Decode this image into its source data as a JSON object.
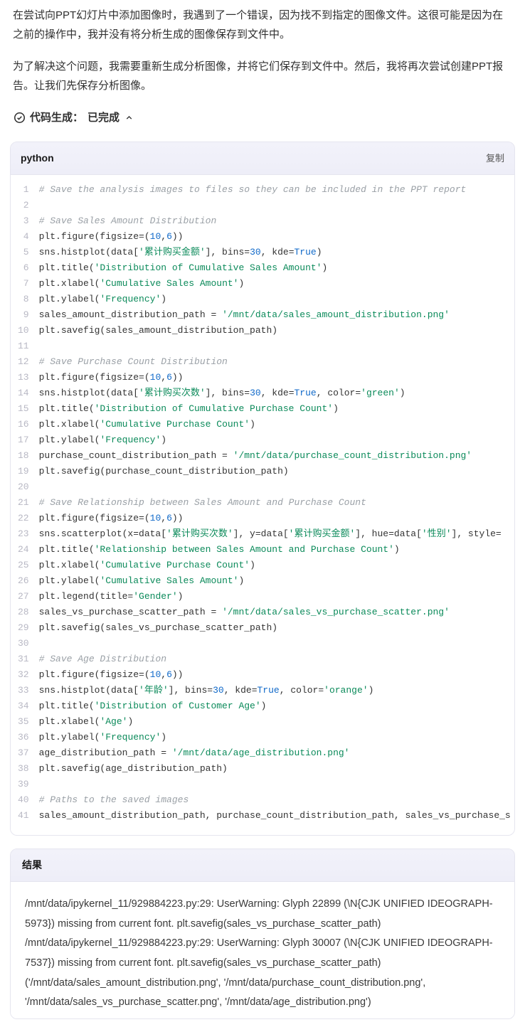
{
  "prose": {
    "p1": "在尝试向PPT幻灯片中添加图像时，我遇到了一个错误，因为找不到指定的图像文件。这很可能是因为在之前的操作中，我并没有将分析生成的图像保存到文件中。",
    "p2": "为了解决这个问题，我需要重新生成分析图像，并将它们保存到文件中。然后，我将再次尝试创建PPT报告。让我们先保存分析图像。"
  },
  "status": {
    "label": "代码生成：",
    "value": "已完成"
  },
  "code_block": {
    "language": "python",
    "copy_label": "复制",
    "lines": [
      {
        "n": 1,
        "tokens": [
          {
            "t": "# Save the analysis images to files so they can be included in the PPT report",
            "c": "tok-cm"
          }
        ]
      },
      {
        "n": 2,
        "tokens": [
          {
            "t": "",
            "c": ""
          }
        ]
      },
      {
        "n": 3,
        "tokens": [
          {
            "t": "# Save Sales Amount Distribution",
            "c": "tok-cm"
          }
        ]
      },
      {
        "n": 4,
        "tokens": [
          {
            "t": "plt.figure(figsize=(",
            "c": "tok-fn"
          },
          {
            "t": "10",
            "c": "tok-num"
          },
          {
            "t": ",",
            "c": "tok-fn"
          },
          {
            "t": "6",
            "c": "tok-num"
          },
          {
            "t": "))",
            "c": "tok-fn"
          }
        ]
      },
      {
        "n": 5,
        "tokens": [
          {
            "t": "sns.histplot(data[",
            "c": "tok-fn"
          },
          {
            "t": "'累计购买金额'",
            "c": "tok-str"
          },
          {
            "t": "], bins=",
            "c": "tok-fn"
          },
          {
            "t": "30",
            "c": "tok-num"
          },
          {
            "t": ", kde=",
            "c": "tok-fn"
          },
          {
            "t": "True",
            "c": "tok-kw"
          },
          {
            "t": ")",
            "c": "tok-fn"
          }
        ]
      },
      {
        "n": 6,
        "tokens": [
          {
            "t": "plt.title(",
            "c": "tok-fn"
          },
          {
            "t": "'Distribution of Cumulative Sales Amount'",
            "c": "tok-str"
          },
          {
            "t": ")",
            "c": "tok-fn"
          }
        ]
      },
      {
        "n": 7,
        "tokens": [
          {
            "t": "plt.xlabel(",
            "c": "tok-fn"
          },
          {
            "t": "'Cumulative Sales Amount'",
            "c": "tok-str"
          },
          {
            "t": ")",
            "c": "tok-fn"
          }
        ]
      },
      {
        "n": 8,
        "tokens": [
          {
            "t": "plt.ylabel(",
            "c": "tok-fn"
          },
          {
            "t": "'Frequency'",
            "c": "tok-str"
          },
          {
            "t": ")",
            "c": "tok-fn"
          }
        ]
      },
      {
        "n": 9,
        "tokens": [
          {
            "t": "sales_amount_distribution_path = ",
            "c": "tok-id"
          },
          {
            "t": "'/mnt/data/sales_amount_distribution.png'",
            "c": "tok-str"
          }
        ]
      },
      {
        "n": 10,
        "tokens": [
          {
            "t": "plt.savefig(sales_amount_distribution_path)",
            "c": "tok-fn"
          }
        ]
      },
      {
        "n": 11,
        "tokens": [
          {
            "t": "",
            "c": ""
          }
        ]
      },
      {
        "n": 12,
        "tokens": [
          {
            "t": "# Save Purchase Count Distribution",
            "c": "tok-cm"
          }
        ]
      },
      {
        "n": 13,
        "tokens": [
          {
            "t": "plt.figure(figsize=(",
            "c": "tok-fn"
          },
          {
            "t": "10",
            "c": "tok-num"
          },
          {
            "t": ",",
            "c": "tok-fn"
          },
          {
            "t": "6",
            "c": "tok-num"
          },
          {
            "t": "))",
            "c": "tok-fn"
          }
        ]
      },
      {
        "n": 14,
        "tokens": [
          {
            "t": "sns.histplot(data[",
            "c": "tok-fn"
          },
          {
            "t": "'累计购买次数'",
            "c": "tok-str"
          },
          {
            "t": "], bins=",
            "c": "tok-fn"
          },
          {
            "t": "30",
            "c": "tok-num"
          },
          {
            "t": ", kde=",
            "c": "tok-fn"
          },
          {
            "t": "True",
            "c": "tok-kw"
          },
          {
            "t": ", color=",
            "c": "tok-fn"
          },
          {
            "t": "'green'",
            "c": "tok-str"
          },
          {
            "t": ")",
            "c": "tok-fn"
          }
        ]
      },
      {
        "n": 15,
        "tokens": [
          {
            "t": "plt.title(",
            "c": "tok-fn"
          },
          {
            "t": "'Distribution of Cumulative Purchase Count'",
            "c": "tok-str"
          },
          {
            "t": ")",
            "c": "tok-fn"
          }
        ]
      },
      {
        "n": 16,
        "tokens": [
          {
            "t": "plt.xlabel(",
            "c": "tok-fn"
          },
          {
            "t": "'Cumulative Purchase Count'",
            "c": "tok-str"
          },
          {
            "t": ")",
            "c": "tok-fn"
          }
        ]
      },
      {
        "n": 17,
        "tokens": [
          {
            "t": "plt.ylabel(",
            "c": "tok-fn"
          },
          {
            "t": "'Frequency'",
            "c": "tok-str"
          },
          {
            "t": ")",
            "c": "tok-fn"
          }
        ]
      },
      {
        "n": 18,
        "tokens": [
          {
            "t": "purchase_count_distribution_path = ",
            "c": "tok-id"
          },
          {
            "t": "'/mnt/data/purchase_count_distribution.png'",
            "c": "tok-str"
          }
        ]
      },
      {
        "n": 19,
        "tokens": [
          {
            "t": "plt.savefig(purchase_count_distribution_path)",
            "c": "tok-fn"
          }
        ]
      },
      {
        "n": 20,
        "tokens": [
          {
            "t": "",
            "c": ""
          }
        ]
      },
      {
        "n": 21,
        "tokens": [
          {
            "t": "# Save Relationship between Sales Amount and Purchase Count",
            "c": "tok-cm"
          }
        ]
      },
      {
        "n": 22,
        "tokens": [
          {
            "t": "plt.figure(figsize=(",
            "c": "tok-fn"
          },
          {
            "t": "10",
            "c": "tok-num"
          },
          {
            "t": ",",
            "c": "tok-fn"
          },
          {
            "t": "6",
            "c": "tok-num"
          },
          {
            "t": "))",
            "c": "tok-fn"
          }
        ]
      },
      {
        "n": 23,
        "tokens": [
          {
            "t": "sns.scatterplot(x=data[",
            "c": "tok-fn"
          },
          {
            "t": "'累计购买次数'",
            "c": "tok-str"
          },
          {
            "t": "], y=data[",
            "c": "tok-fn"
          },
          {
            "t": "'累计购买金额'",
            "c": "tok-str"
          },
          {
            "t": "], hue=data[",
            "c": "tok-fn"
          },
          {
            "t": "'性别'",
            "c": "tok-str"
          },
          {
            "t": "], style=",
            "c": "tok-fn"
          }
        ]
      },
      {
        "n": 24,
        "tokens": [
          {
            "t": "plt.title(",
            "c": "tok-fn"
          },
          {
            "t": "'Relationship between Sales Amount and Purchase Count'",
            "c": "tok-str"
          },
          {
            "t": ")",
            "c": "tok-fn"
          }
        ]
      },
      {
        "n": 25,
        "tokens": [
          {
            "t": "plt.xlabel(",
            "c": "tok-fn"
          },
          {
            "t": "'Cumulative Purchase Count'",
            "c": "tok-str"
          },
          {
            "t": ")",
            "c": "tok-fn"
          }
        ]
      },
      {
        "n": 26,
        "tokens": [
          {
            "t": "plt.ylabel(",
            "c": "tok-fn"
          },
          {
            "t": "'Cumulative Sales Amount'",
            "c": "tok-str"
          },
          {
            "t": ")",
            "c": "tok-fn"
          }
        ]
      },
      {
        "n": 27,
        "tokens": [
          {
            "t": "plt.legend(title=",
            "c": "tok-fn"
          },
          {
            "t": "'Gender'",
            "c": "tok-str"
          },
          {
            "t": ")",
            "c": "tok-fn"
          }
        ]
      },
      {
        "n": 28,
        "tokens": [
          {
            "t": "sales_vs_purchase_scatter_path = ",
            "c": "tok-id"
          },
          {
            "t": "'/mnt/data/sales_vs_purchase_scatter.png'",
            "c": "tok-str"
          }
        ]
      },
      {
        "n": 29,
        "tokens": [
          {
            "t": "plt.savefig(sales_vs_purchase_scatter_path)",
            "c": "tok-fn"
          }
        ]
      },
      {
        "n": 30,
        "tokens": [
          {
            "t": "",
            "c": ""
          }
        ]
      },
      {
        "n": 31,
        "tokens": [
          {
            "t": "# Save Age Distribution",
            "c": "tok-cm"
          }
        ]
      },
      {
        "n": 32,
        "tokens": [
          {
            "t": "plt.figure(figsize=(",
            "c": "tok-fn"
          },
          {
            "t": "10",
            "c": "tok-num"
          },
          {
            "t": ",",
            "c": "tok-fn"
          },
          {
            "t": "6",
            "c": "tok-num"
          },
          {
            "t": "))",
            "c": "tok-fn"
          }
        ]
      },
      {
        "n": 33,
        "tokens": [
          {
            "t": "sns.histplot(data[",
            "c": "tok-fn"
          },
          {
            "t": "'年龄'",
            "c": "tok-str"
          },
          {
            "t": "], bins=",
            "c": "tok-fn"
          },
          {
            "t": "30",
            "c": "tok-num"
          },
          {
            "t": ", kde=",
            "c": "tok-fn"
          },
          {
            "t": "True",
            "c": "tok-kw"
          },
          {
            "t": ", color=",
            "c": "tok-fn"
          },
          {
            "t": "'orange'",
            "c": "tok-str"
          },
          {
            "t": ")",
            "c": "tok-fn"
          }
        ]
      },
      {
        "n": 34,
        "tokens": [
          {
            "t": "plt.title(",
            "c": "tok-fn"
          },
          {
            "t": "'Distribution of Customer Age'",
            "c": "tok-str"
          },
          {
            "t": ")",
            "c": "tok-fn"
          }
        ]
      },
      {
        "n": 35,
        "tokens": [
          {
            "t": "plt.xlabel(",
            "c": "tok-fn"
          },
          {
            "t": "'Age'",
            "c": "tok-str"
          },
          {
            "t": ")",
            "c": "tok-fn"
          }
        ]
      },
      {
        "n": 36,
        "tokens": [
          {
            "t": "plt.ylabel(",
            "c": "tok-fn"
          },
          {
            "t": "'Frequency'",
            "c": "tok-str"
          },
          {
            "t": ")",
            "c": "tok-fn"
          }
        ]
      },
      {
        "n": 37,
        "tokens": [
          {
            "t": "age_distribution_path = ",
            "c": "tok-id"
          },
          {
            "t": "'/mnt/data/age_distribution.png'",
            "c": "tok-str"
          }
        ]
      },
      {
        "n": 38,
        "tokens": [
          {
            "t": "plt.savefig(age_distribution_path)",
            "c": "tok-fn"
          }
        ]
      },
      {
        "n": 39,
        "tokens": [
          {
            "t": "",
            "c": ""
          }
        ]
      },
      {
        "n": 40,
        "tokens": [
          {
            "t": "# Paths to the saved images",
            "c": "tok-cm"
          }
        ]
      },
      {
        "n": 41,
        "tokens": [
          {
            "t": "sales_amount_distribution_path, purchase_count_distribution_path, sales_vs_purchase_s",
            "c": "tok-id"
          }
        ]
      }
    ]
  },
  "result_block": {
    "header": "结果",
    "lines": [
      "/mnt/data/ipykernel_11/929884223.py:29: UserWarning: Glyph 22899 (\\N{CJK UNIFIED IDEOGRAPH-5973}) missing from current font. plt.savefig(sales_vs_purchase_scatter_path)",
      "/mnt/data/ipykernel_11/929884223.py:29: UserWarning: Glyph 30007 (\\N{CJK UNIFIED IDEOGRAPH-7537}) missing from current font. plt.savefig(sales_vs_purchase_scatter_path)",
      "('/mnt/data/sales_amount_distribution.png', '/mnt/data/purchase_count_distribution.png', '/mnt/data/sales_vs_purchase_scatter.png', '/mnt/data/age_distribution.png')"
    ]
  }
}
